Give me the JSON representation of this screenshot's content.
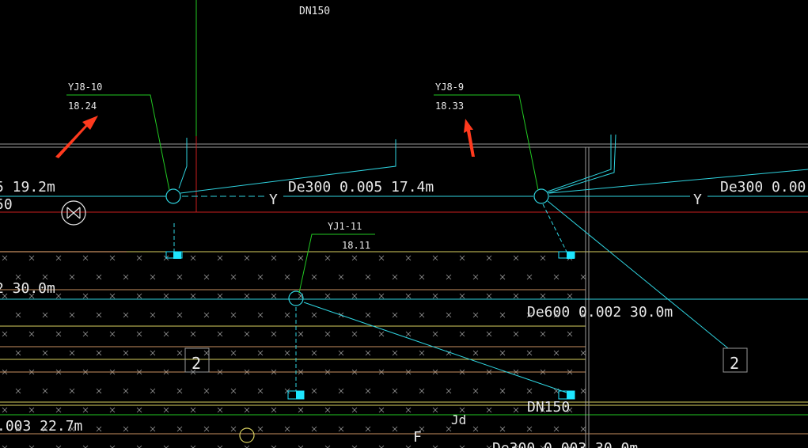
{
  "colors": {
    "background": "#000000",
    "cyan": "#2fd4e0",
    "green": "#22c822",
    "red": "#c81e1e",
    "gray": "#9a9a9a",
    "yellow": "#d8d060",
    "orange": "#c89060",
    "white": "#e8e8e8",
    "marker": "#1ee6ff",
    "arrow": "#ff3a1e"
  },
  "labels": {
    "top_dn": "DN150",
    "left_pipe_spec": "5  19.2m",
    "left_pipe_tail": "50",
    "pipe_spec_1": "De300  0.005  17.4m",
    "pipe_spec_2": "De300  0.00",
    "pipe_spec_3": "De600  0.002  30.0m",
    "left_mid_spec": "2  30.0m",
    "left_bottom_spec": ".003  22.7m",
    "bottom_spec": "De300  0.003  30.0m",
    "bottom_dn": "DN150",
    "jd": "Jd",
    "f_label": "F",
    "y1": "Y",
    "y2": "Y"
  },
  "wells": [
    {
      "id": "YJ8-10",
      "elevation": "18.24"
    },
    {
      "id": "YJ8-9",
      "elevation": "18.33"
    },
    {
      "id": "YJ1-11",
      "elevation": "18.11"
    }
  ],
  "tags": [
    "2",
    "2"
  ],
  "icons": [
    "valve-icon",
    "arrow-icon"
  ]
}
